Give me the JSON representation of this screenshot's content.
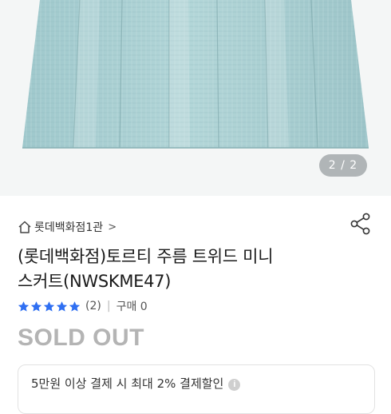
{
  "gallery": {
    "counter": "2 / 2",
    "image_subject": "mint tweed pleated mini skirt"
  },
  "product": {
    "store_name": "롯데백화점1관",
    "store_chevron": ">",
    "title_line1": "(롯데백화점)토르티 주름 트위드 미니",
    "title_line2": "스커트(NWSKME47)",
    "rating_stars": 5,
    "review_count": "(2)",
    "purchase_label": "구매 0",
    "separator": "|",
    "status": "SOLD OUT"
  },
  "promo": {
    "text": "5만원 이상 결제 시 최대 2% 결제할인",
    "info_icon": "i"
  },
  "colors": {
    "star": "#2f6ff2",
    "soldout": "#b4b4b4",
    "skirt": "#a9cfd2"
  },
  "icons": [
    "home-icon",
    "share-icon",
    "star-icon",
    "info-icon"
  ]
}
